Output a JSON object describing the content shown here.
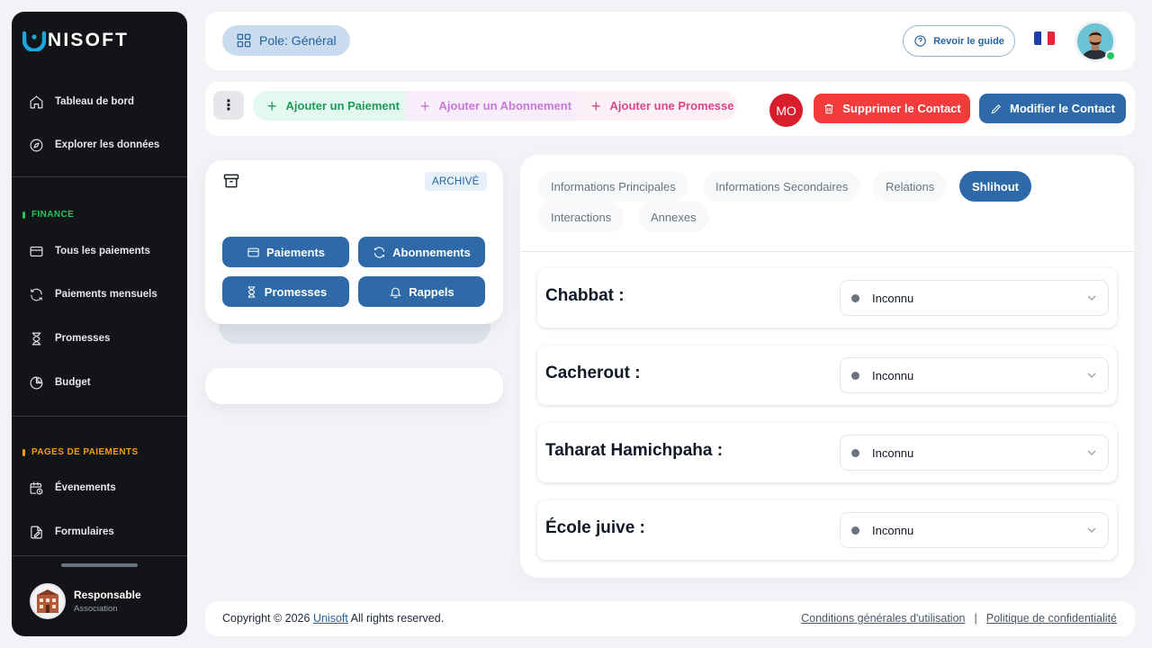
{
  "sidebar": {
    "logo_text": "NISOFT",
    "items_top": [
      {
        "label": "Tableau de bord",
        "icon": "home-icon"
      },
      {
        "label": "Explorer les données",
        "icon": "compass-icon"
      }
    ],
    "finance_section": "FINANCE",
    "finance_items": [
      {
        "label": "Tous les paiements",
        "icon": "credit-card-icon"
      },
      {
        "label": "Paiements mensuels",
        "icon": "refresh-icon"
      },
      {
        "label": "Promesses",
        "icon": "hourglass-icon"
      },
      {
        "label": "Budget",
        "icon": "pie-chart-icon"
      }
    ],
    "payment_pages_section": "PAGES DE PAIEMENTS",
    "payment_pages_items": [
      {
        "label": "Évenements",
        "icon": "calendar-clock-icon"
      },
      {
        "label": "Formulaires",
        "icon": "form-icon"
      }
    ],
    "user": {
      "name": "Responsable",
      "role": "Association"
    },
    "colors": {
      "finance": "#22c55e",
      "payment_pages": "#f59e0b"
    }
  },
  "header": {
    "pole_label": "Pole: Général",
    "guide_label": "Revoir le guide"
  },
  "actions": {
    "add_payment": "Ajouter un Paiement",
    "add_subscription": "Ajouter un Abonnement",
    "add_promise": "Ajouter une Promesse",
    "initials": "MO",
    "delete_contact": "Supprimer le Contact",
    "edit_contact": "Modifier le Contact"
  },
  "left_panel": {
    "archive_badge": "ARCHIVÉ",
    "buttons": {
      "payments": "Paiements",
      "subscriptions": "Abonnements",
      "promises": "Promesses",
      "reminders": "Rappels"
    }
  },
  "tabs": {
    "main_info": "Informations Principales",
    "secondary_info": "Informations Secondaires",
    "relations": "Relations",
    "shlihout": "Shlihout",
    "interactions": "Interactions",
    "annexes": "Annexes"
  },
  "fields": [
    {
      "label": "Chabbat :",
      "value": "Inconnu"
    },
    {
      "label": "Cacherout :",
      "value": "Inconnu"
    },
    {
      "label": "Taharat Hamichpaha :",
      "value": "Inconnu"
    },
    {
      "label": "École juive :",
      "value": "Inconnu"
    }
  ],
  "footer": {
    "copy_prefix": "Copyright © 2026",
    "brand_link": "Unisoft",
    "copy_suffix": "All rights reserved.",
    "terms": "Conditions générales d'utilisation",
    "separator": "|",
    "privacy": "Politique de confidentialité"
  }
}
